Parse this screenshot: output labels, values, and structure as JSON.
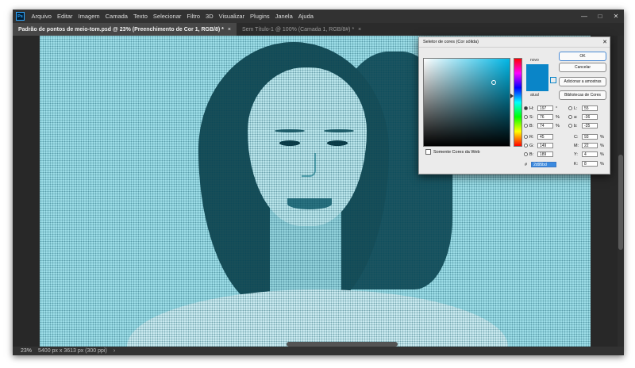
{
  "app": {
    "logo": "Ps",
    "menu": [
      "Arquivo",
      "Editar",
      "Imagem",
      "Camada",
      "Texto",
      "Selecionar",
      "Filtro",
      "3D",
      "Visualizar",
      "Plugins",
      "Janela",
      "Ajuda"
    ],
    "window_controls": {
      "minimize": "—",
      "maximize": "□",
      "close": "✕"
    }
  },
  "tabs": [
    {
      "label": "Padrão de pontos de meio-tom.psd @ 23% (Preenchimento de Cor 1, RGB/8) *",
      "close": "×"
    },
    {
      "label": "Sem Título-1 @ 100% (Camada 1, RGB/8#) *",
      "close": "×"
    }
  ],
  "status": {
    "zoom": "23%",
    "info": "5400 px x 3613 px (300 ppi)",
    "arrow": "›"
  },
  "colors": {
    "accent": "#0a85c8",
    "halftone_bg": "#a6e6ef",
    "ok_border": "#4a8ad4"
  },
  "dialog": {
    "title": "Seletor de cores (Cor sólida)",
    "close": "✕",
    "new_label": "novo",
    "current_label": "atual",
    "new_color": "#0a85c8",
    "current_color": "#0a85c8",
    "buttons": {
      "ok": "OK",
      "cancel": "Cancelar",
      "add_swatches": "Adicionar a amostras",
      "libraries": "Bibliotecas de Cores"
    },
    "web_only": "Somente Cores da Web",
    "hsb": [
      {
        "label": "H:",
        "value": "197",
        "unit": "°",
        "selected": true
      },
      {
        "label": "S:",
        "value": "76",
        "unit": "%",
        "selected": false
      },
      {
        "label": "B:",
        "value": "74",
        "unit": "%",
        "selected": false
      }
    ],
    "rgb": [
      {
        "label": "R:",
        "value": "45",
        "unit": ""
      },
      {
        "label": "G:",
        "value": "149",
        "unit": ""
      },
      {
        "label": "B:",
        "value": "189",
        "unit": ""
      }
    ],
    "lab": [
      {
        "label": "L:",
        "value": "55",
        "unit": ""
      },
      {
        "label": "a:",
        "value": "-36",
        "unit": ""
      },
      {
        "label": "b:",
        "value": "-35",
        "unit": ""
      }
    ],
    "cmyk": [
      {
        "label": "C:",
        "value": "93",
        "unit": "%"
      },
      {
        "label": "M:",
        "value": "22",
        "unit": "%"
      },
      {
        "label": "Y:",
        "value": "4",
        "unit": "%"
      },
      {
        "label": "K:",
        "value": "8",
        "unit": "%"
      }
    ],
    "hex_label": "#",
    "hex_value": "2d95bd"
  }
}
